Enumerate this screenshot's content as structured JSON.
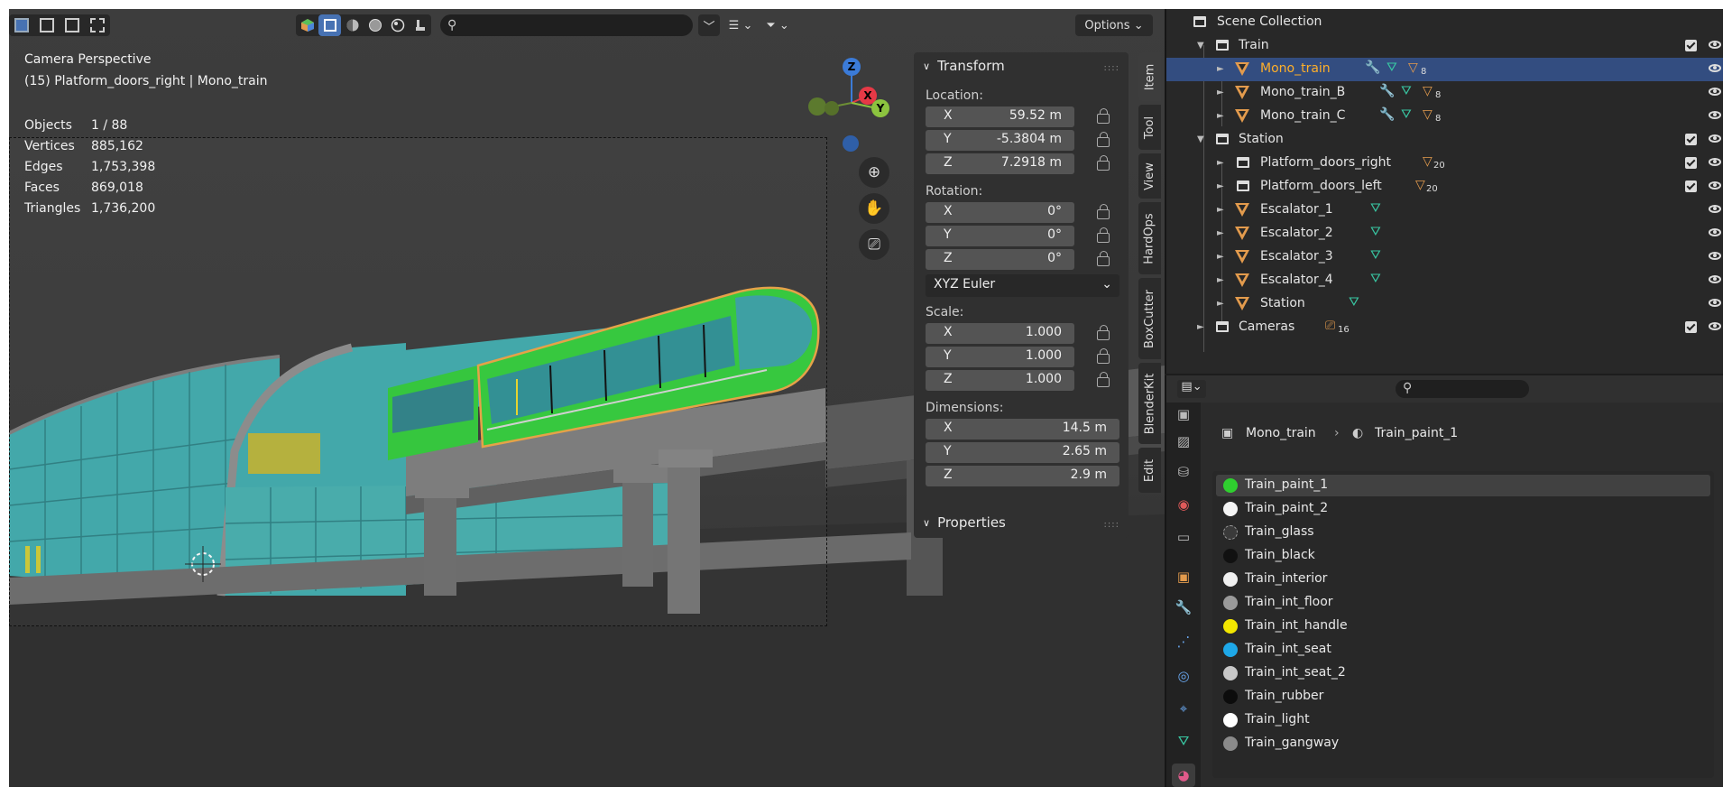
{
  "viewport": {
    "view_name": "Camera Perspective",
    "object_info": "(15) Platform_doors_right | Mono_train",
    "stats": [
      {
        "k": "Objects",
        "v": "1 / 88"
      },
      {
        "k": "Vertices",
        "v": "885,162"
      },
      {
        "k": "Edges",
        "v": "1,753,398"
      },
      {
        "k": "Faces",
        "v": "869,018"
      },
      {
        "k": "Triangles",
        "v": "1,736,200"
      }
    ],
    "options_label": "Options",
    "gizmo": {
      "z": "Z",
      "x": "X",
      "y": "Y"
    }
  },
  "transform": {
    "title": "Transform",
    "location_label": "Location:",
    "location": [
      {
        "ax": "X",
        "v": "59.52 m"
      },
      {
        "ax": "Y",
        "v": "-5.3804 m"
      },
      {
        "ax": "Z",
        "v": "7.2918 m"
      }
    ],
    "rotation_label": "Rotation:",
    "rotation": [
      {
        "ax": "X",
        "v": "0°"
      },
      {
        "ax": "Y",
        "v": "0°"
      },
      {
        "ax": "Z",
        "v": "0°"
      }
    ],
    "rotation_mode": "XYZ Euler",
    "scale_label": "Scale:",
    "scale": [
      {
        "ax": "X",
        "v": "1.000"
      },
      {
        "ax": "Y",
        "v": "1.000"
      },
      {
        "ax": "Z",
        "v": "1.000"
      }
    ],
    "dimensions_label": "Dimensions:",
    "dimensions": [
      {
        "ax": "X",
        "v": "14.5 m"
      },
      {
        "ax": "Y",
        "v": "2.65 m"
      },
      {
        "ax": "Z",
        "v": "2.9 m"
      }
    ],
    "properties_title": "Properties"
  },
  "side_tabs": [
    "Item",
    "Tool",
    "View",
    "HardOps",
    "BoxCutter",
    "BlenderKit",
    "Edit"
  ],
  "outliner": {
    "root": "Scene Collection",
    "rows": [
      {
        "label": "Train",
        "type": "collection"
      },
      {
        "label": "Mono_train",
        "type": "mesh",
        "badge": "8"
      },
      {
        "label": "Mono_train_B",
        "type": "mesh",
        "badge": "8"
      },
      {
        "label": "Mono_train_C",
        "type": "mesh",
        "badge": "8"
      },
      {
        "label": "Station",
        "type": "collection"
      },
      {
        "label": "Platform_doors_right",
        "type": "collection-instance",
        "badge": "20"
      },
      {
        "label": "Platform_doors_left",
        "type": "collection-instance",
        "badge": "20"
      },
      {
        "label": "Escalator_1",
        "type": "mesh"
      },
      {
        "label": "Escalator_2",
        "type": "mesh"
      },
      {
        "label": "Escalator_3",
        "type": "mesh"
      },
      {
        "label": "Escalator_4",
        "type": "mesh"
      },
      {
        "label": "Station",
        "type": "mesh"
      },
      {
        "label": "Cameras",
        "type": "collection",
        "badge": "16"
      }
    ]
  },
  "properties": {
    "breadcrumb_object": "Mono_train",
    "breadcrumb_material": "Train_paint_1",
    "materials": [
      {
        "name": "Train_paint_1",
        "color": "#2fcf2f"
      },
      {
        "name": "Train_paint_2",
        "color": "#f4f4f4"
      },
      {
        "name": "Train_glass",
        "color": "#3a3a3a"
      },
      {
        "name": "Train_black",
        "color": "#111111"
      },
      {
        "name": "Train_interior",
        "color": "#f0f0f0"
      },
      {
        "name": "Train_int_floor",
        "color": "#9a9a9a"
      },
      {
        "name": "Train_int_handle",
        "color": "#f2e600"
      },
      {
        "name": "Train_int_seat",
        "color": "#1ea8e8"
      },
      {
        "name": "Train_int_seat_2",
        "color": "#c8c8c8"
      },
      {
        "name": "Train_rubber",
        "color": "#0c0c0c"
      },
      {
        "name": "Train_light",
        "color": "#ffffff"
      },
      {
        "name": "Train_gangway",
        "color": "#8a8a8a"
      }
    ]
  }
}
